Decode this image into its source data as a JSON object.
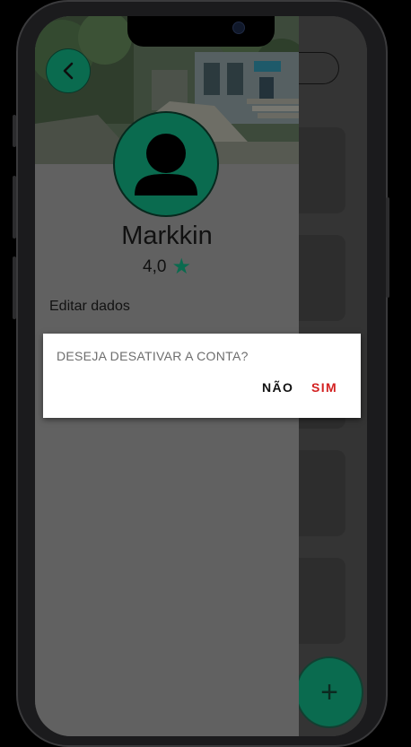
{
  "profile": {
    "name": "Markkin",
    "rating": "4,0",
    "edit_label": "Editar dados"
  },
  "dialog": {
    "message": "DESEJA DESATIVAR A CONTA?",
    "no_label": "NÃO",
    "yes_label": "SIM"
  },
  "colors": {
    "brand_green": "#0a6b4f",
    "destructive_red": "#d32020",
    "drawer_bg": "#616161"
  },
  "icons": {
    "back": "chevron-left-icon",
    "avatar": "person-icon",
    "rating": "star-icon",
    "fab": "plus-icon"
  }
}
